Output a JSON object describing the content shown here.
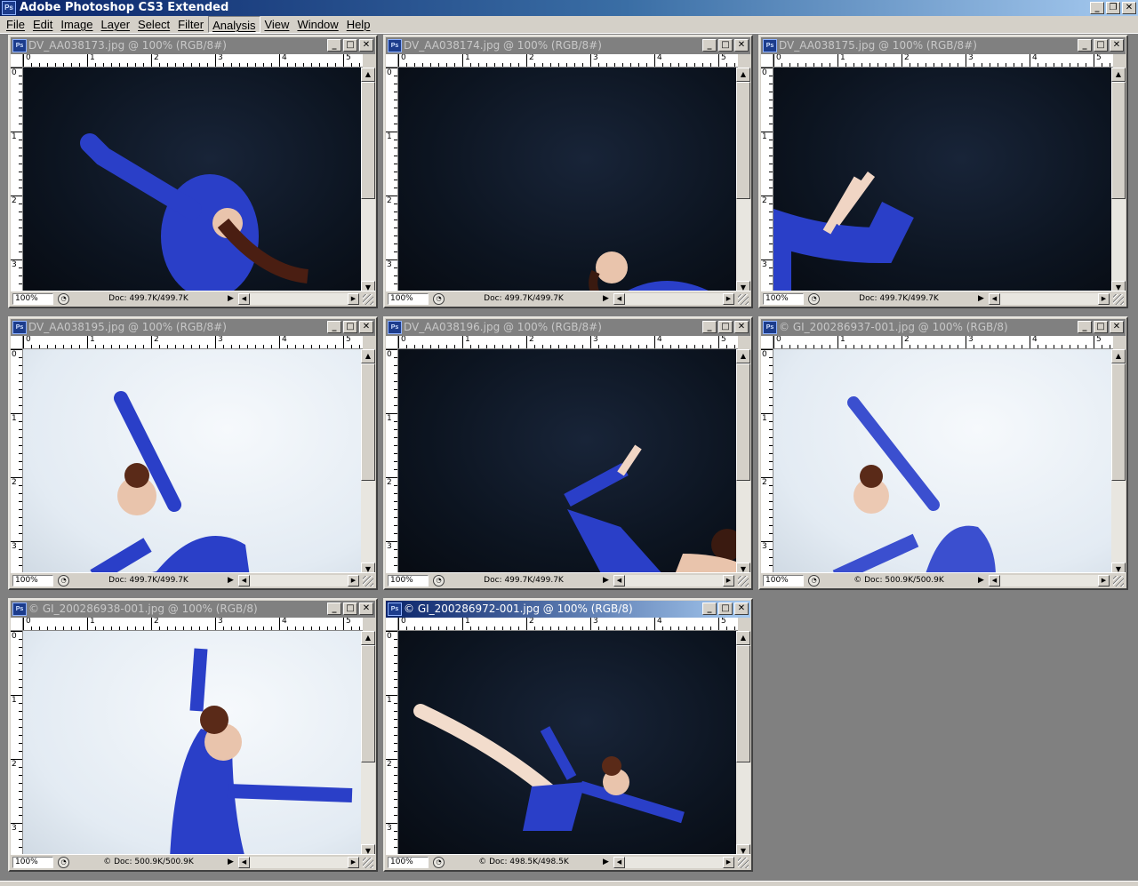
{
  "app": {
    "title": "Adobe Photoshop CS3 Extended",
    "icon": "Ps"
  },
  "window_controls": {
    "minimize": "_",
    "restore": "❐",
    "close": "✕"
  },
  "menu": [
    {
      "label": "File"
    },
    {
      "label": "Edit"
    },
    {
      "label": "Image"
    },
    {
      "label": "Layer"
    },
    {
      "label": "Select"
    },
    {
      "label": "Filter"
    },
    {
      "label": "Analysis",
      "active": true
    },
    {
      "label": "View"
    },
    {
      "label": "Window"
    },
    {
      "label": "Help"
    }
  ],
  "ruler": {
    "h_ticks": [
      "0",
      "1",
      "2",
      "3",
      "4",
      "5"
    ],
    "v_ticks": [
      "0",
      "1",
      "2",
      "3"
    ]
  },
  "documents": [
    {
      "title": "DV_AA038173.jpg @ 100% (RGB/8#)",
      "zoom": "100%",
      "doc_info": "Doc: 499.7K/499.7K",
      "theme": "dark",
      "active": false
    },
    {
      "title": "DV_AA038174.jpg @ 100% (RGB/8#)",
      "zoom": "100%",
      "doc_info": "Doc: 499.7K/499.7K",
      "theme": "dark",
      "active": false
    },
    {
      "title": "DV_AA038175.jpg @ 100% (RGB/8#)",
      "zoom": "100%",
      "doc_info": "Doc: 499.7K/499.7K",
      "theme": "dark",
      "active": false
    },
    {
      "title": "DV_AA038195.jpg @ 100% (RGB/8#)",
      "zoom": "100%",
      "doc_info": "Doc: 499.7K/499.7K",
      "theme": "light",
      "active": false
    },
    {
      "title": "DV_AA038196.jpg @ 100% (RGB/8#)",
      "zoom": "100%",
      "doc_info": "Doc: 499.7K/499.7K",
      "theme": "dark",
      "active": false
    },
    {
      "title": "© GI_200286937-001.jpg @ 100% (RGB/8)",
      "zoom": "100%",
      "doc_info": "© Doc: 500.9K/500.9K",
      "theme": "light",
      "active": false
    },
    {
      "title": "© GI_200286938-001.jpg @ 100% (RGB/8)",
      "zoom": "100%",
      "doc_info": "© Doc: 500.9K/500.9K",
      "theme": "light",
      "active": false
    },
    {
      "title": "© GI_200286972-001.jpg @ 100% (RGB/8)",
      "zoom": "100%",
      "doc_info": "© Doc: 498.5K/498.5K",
      "theme": "dark",
      "active": true
    }
  ],
  "colors": {
    "title_gradient_start": "#0a246a",
    "title_gradient_end": "#a6caf0",
    "workspace": "#808080",
    "chrome": "#d4d0c8",
    "costume_blue": "#2a3fc8"
  }
}
